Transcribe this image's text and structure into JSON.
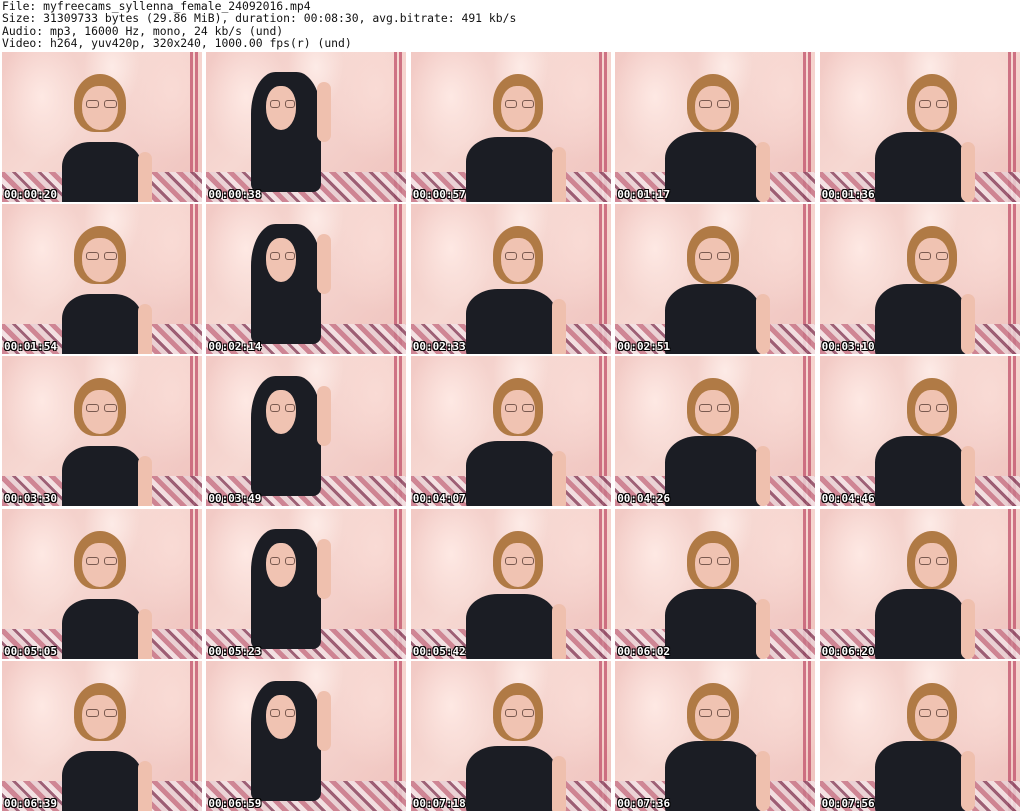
{
  "header": {
    "line1": "File: myfreecams_syllenna_female_24092016.mp4",
    "line2": "Size: 31309733 bytes (29.86 MiB), duration: 00:08:30, avg.bitrate: 491 kb/s",
    "line3": "Audio: mp3, 16000 Hz, mono, 24 kb/s (und)",
    "line4": "Video: h264, yuv420p, 320x240, 1000.00 fps(r) (und)"
  },
  "thumbnails": [
    {
      "timestamp": "00:00:20"
    },
    {
      "timestamp": "00:00:38"
    },
    {
      "timestamp": "00:00:57"
    },
    {
      "timestamp": "00:01:17"
    },
    {
      "timestamp": "00:01:36"
    },
    {
      "timestamp": "00:01:54"
    },
    {
      "timestamp": "00:02:14"
    },
    {
      "timestamp": "00:02:33"
    },
    {
      "timestamp": "00:02:51"
    },
    {
      "timestamp": "00:03:10"
    },
    {
      "timestamp": "00:03:30"
    },
    {
      "timestamp": "00:03:49"
    },
    {
      "timestamp": "00:04:07"
    },
    {
      "timestamp": "00:04:26"
    },
    {
      "timestamp": "00:04:46"
    },
    {
      "timestamp": "00:05:05"
    },
    {
      "timestamp": "00:05:23"
    },
    {
      "timestamp": "00:05:42"
    },
    {
      "timestamp": "00:06:02"
    },
    {
      "timestamp": "00:06:20"
    },
    {
      "timestamp": "00:06:39"
    },
    {
      "timestamp": "00:06:59"
    },
    {
      "timestamp": "00:07:18"
    },
    {
      "timestamp": "00:07:36"
    },
    {
      "timestamp": "00:07:56"
    }
  ]
}
